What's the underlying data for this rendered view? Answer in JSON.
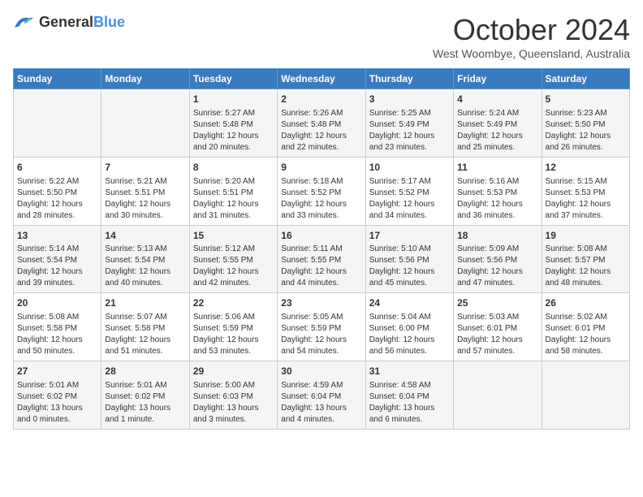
{
  "header": {
    "logo_general": "General",
    "logo_blue": "Blue",
    "month": "October 2024",
    "location": "West Woombye, Queensland, Australia"
  },
  "days_of_week": [
    "Sunday",
    "Monday",
    "Tuesday",
    "Wednesday",
    "Thursday",
    "Friday",
    "Saturday"
  ],
  "weeks": [
    [
      {
        "day": "",
        "info": ""
      },
      {
        "day": "",
        "info": ""
      },
      {
        "day": "1",
        "info": "Sunrise: 5:27 AM\nSunset: 5:48 PM\nDaylight: 12 hours\nand 20 minutes."
      },
      {
        "day": "2",
        "info": "Sunrise: 5:26 AM\nSunset: 5:48 PM\nDaylight: 12 hours\nand 22 minutes."
      },
      {
        "day": "3",
        "info": "Sunrise: 5:25 AM\nSunset: 5:49 PM\nDaylight: 12 hours\nand 23 minutes."
      },
      {
        "day": "4",
        "info": "Sunrise: 5:24 AM\nSunset: 5:49 PM\nDaylight: 12 hours\nand 25 minutes."
      },
      {
        "day": "5",
        "info": "Sunrise: 5:23 AM\nSunset: 5:50 PM\nDaylight: 12 hours\nand 26 minutes."
      }
    ],
    [
      {
        "day": "6",
        "info": "Sunrise: 5:22 AM\nSunset: 5:50 PM\nDaylight: 12 hours\nand 28 minutes."
      },
      {
        "day": "7",
        "info": "Sunrise: 5:21 AM\nSunset: 5:51 PM\nDaylight: 12 hours\nand 30 minutes."
      },
      {
        "day": "8",
        "info": "Sunrise: 5:20 AM\nSunset: 5:51 PM\nDaylight: 12 hours\nand 31 minutes."
      },
      {
        "day": "9",
        "info": "Sunrise: 5:18 AM\nSunset: 5:52 PM\nDaylight: 12 hours\nand 33 minutes."
      },
      {
        "day": "10",
        "info": "Sunrise: 5:17 AM\nSunset: 5:52 PM\nDaylight: 12 hours\nand 34 minutes."
      },
      {
        "day": "11",
        "info": "Sunrise: 5:16 AM\nSunset: 5:53 PM\nDaylight: 12 hours\nand 36 minutes."
      },
      {
        "day": "12",
        "info": "Sunrise: 5:15 AM\nSunset: 5:53 PM\nDaylight: 12 hours\nand 37 minutes."
      }
    ],
    [
      {
        "day": "13",
        "info": "Sunrise: 5:14 AM\nSunset: 5:54 PM\nDaylight: 12 hours\nand 39 minutes."
      },
      {
        "day": "14",
        "info": "Sunrise: 5:13 AM\nSunset: 5:54 PM\nDaylight: 12 hours\nand 40 minutes."
      },
      {
        "day": "15",
        "info": "Sunrise: 5:12 AM\nSunset: 5:55 PM\nDaylight: 12 hours\nand 42 minutes."
      },
      {
        "day": "16",
        "info": "Sunrise: 5:11 AM\nSunset: 5:55 PM\nDaylight: 12 hours\nand 44 minutes."
      },
      {
        "day": "17",
        "info": "Sunrise: 5:10 AM\nSunset: 5:56 PM\nDaylight: 12 hours\nand 45 minutes."
      },
      {
        "day": "18",
        "info": "Sunrise: 5:09 AM\nSunset: 5:56 PM\nDaylight: 12 hours\nand 47 minutes."
      },
      {
        "day": "19",
        "info": "Sunrise: 5:08 AM\nSunset: 5:57 PM\nDaylight: 12 hours\nand 48 minutes."
      }
    ],
    [
      {
        "day": "20",
        "info": "Sunrise: 5:08 AM\nSunset: 5:58 PM\nDaylight: 12 hours\nand 50 minutes."
      },
      {
        "day": "21",
        "info": "Sunrise: 5:07 AM\nSunset: 5:58 PM\nDaylight: 12 hours\nand 51 minutes."
      },
      {
        "day": "22",
        "info": "Sunrise: 5:06 AM\nSunset: 5:59 PM\nDaylight: 12 hours\nand 53 minutes."
      },
      {
        "day": "23",
        "info": "Sunrise: 5:05 AM\nSunset: 5:59 PM\nDaylight: 12 hours\nand 54 minutes."
      },
      {
        "day": "24",
        "info": "Sunrise: 5:04 AM\nSunset: 6:00 PM\nDaylight: 12 hours\nand 56 minutes."
      },
      {
        "day": "25",
        "info": "Sunrise: 5:03 AM\nSunset: 6:01 PM\nDaylight: 12 hours\nand 57 minutes."
      },
      {
        "day": "26",
        "info": "Sunrise: 5:02 AM\nSunset: 6:01 PM\nDaylight: 12 hours\nand 58 minutes."
      }
    ],
    [
      {
        "day": "27",
        "info": "Sunrise: 5:01 AM\nSunset: 6:02 PM\nDaylight: 13 hours\nand 0 minutes."
      },
      {
        "day": "28",
        "info": "Sunrise: 5:01 AM\nSunset: 6:02 PM\nDaylight: 13 hours\nand 1 minute."
      },
      {
        "day": "29",
        "info": "Sunrise: 5:00 AM\nSunset: 6:03 PM\nDaylight: 13 hours\nand 3 minutes."
      },
      {
        "day": "30",
        "info": "Sunrise: 4:59 AM\nSunset: 6:04 PM\nDaylight: 13 hours\nand 4 minutes."
      },
      {
        "day": "31",
        "info": "Sunrise: 4:58 AM\nSunset: 6:04 PM\nDaylight: 13 hours\nand 6 minutes."
      },
      {
        "day": "",
        "info": ""
      },
      {
        "day": "",
        "info": ""
      }
    ]
  ]
}
